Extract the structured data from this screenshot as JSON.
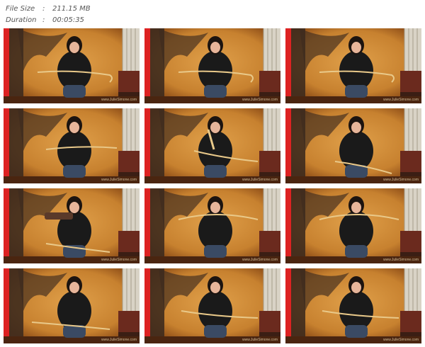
{
  "file_info": {
    "size_label": "File Size",
    "size_value": "211.15 MB",
    "duration_label": "Duration",
    "duration_value": "00:05:35",
    "separator": ":"
  },
  "thumbnails": [
    {
      "watermark": "www.JulieSimone.com",
      "pose": "cane-held-across"
    },
    {
      "watermark": "www.JulieSimone.com",
      "pose": "cane-held-across"
    },
    {
      "watermark": "www.JulieSimone.com",
      "pose": "cane-held-across"
    },
    {
      "watermark": "www.JulieSimone.com",
      "pose": "cane-tapping"
    },
    {
      "watermark": "www.JulieSimone.com",
      "pose": "cane-raised"
    },
    {
      "watermark": "www.JulieSimone.com",
      "pose": "hand-raised"
    },
    {
      "watermark": "www.JulieSimone.com",
      "pose": "paddle-held"
    },
    {
      "watermark": "www.JulieSimone.com",
      "pose": "cane-bent"
    },
    {
      "watermark": "www.JulieSimone.com",
      "pose": "cane-bent"
    },
    {
      "watermark": "www.JulieSimone.com",
      "pose": "hand-on-chest"
    },
    {
      "watermark": "www.JulieSimone.com",
      "pose": "cane-pointed"
    },
    {
      "watermark": "www.JulieSimone.com",
      "pose": "cane-pointed"
    }
  ],
  "colors": {
    "wall": "#c7812f",
    "wall_dark": "#8a4a16",
    "curtain": "#3e2b1e",
    "outfit": "#1a1a1a",
    "jeans": "#3a4a63",
    "cane": "#e9c98a"
  }
}
